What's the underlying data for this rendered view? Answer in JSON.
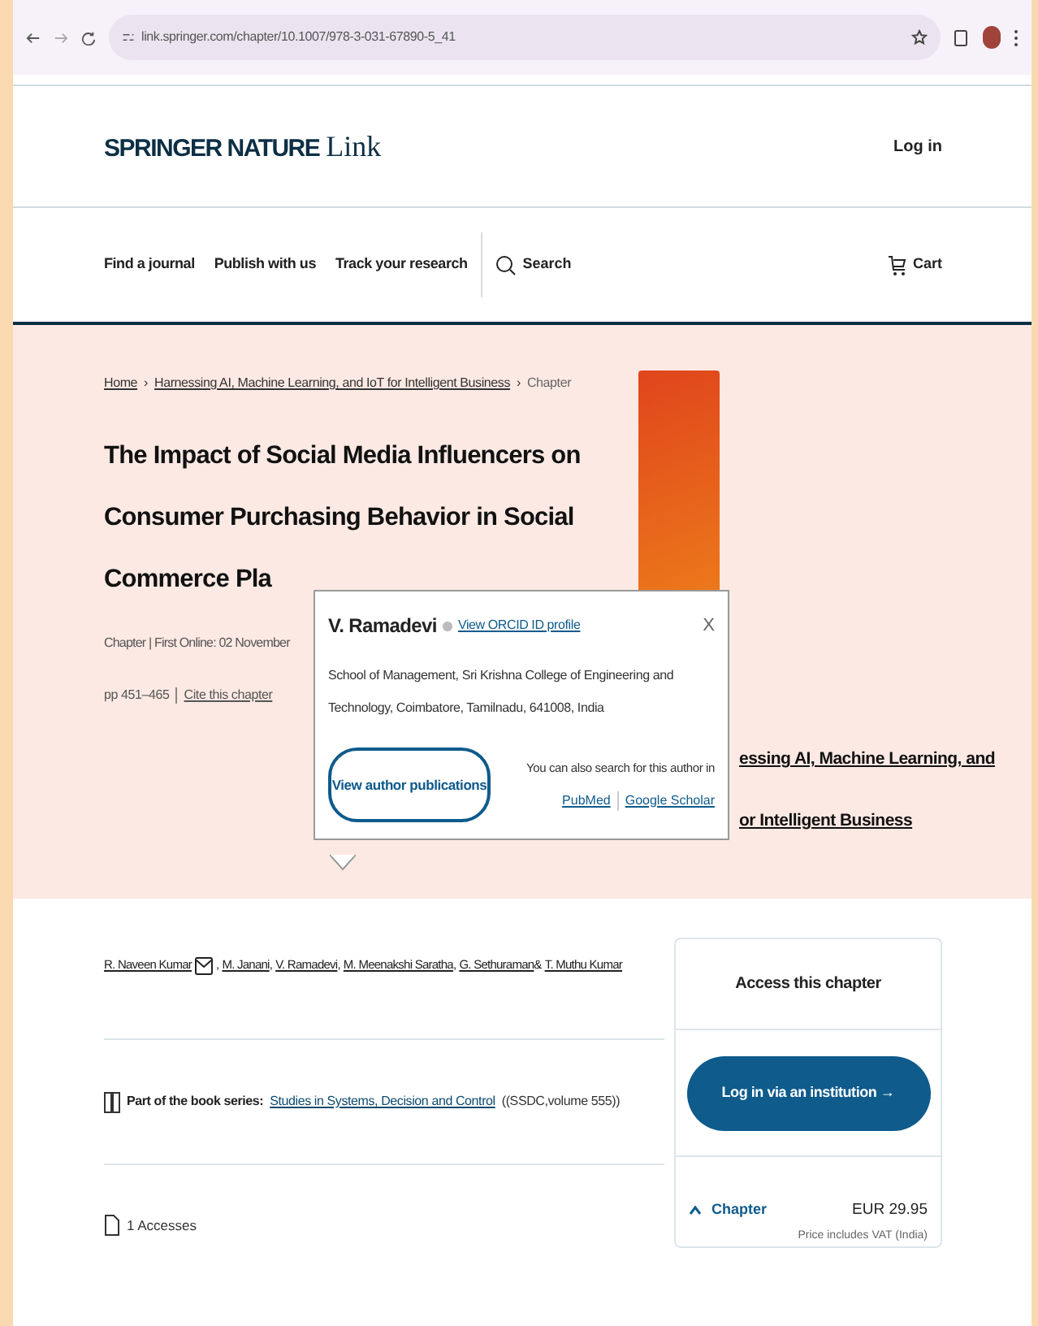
{
  "browser": {
    "url": "link.springer.com/chapter/10.1007/978-3-031-67890-5_41"
  },
  "header": {
    "logo_bold": "SPRINGER NATURE",
    "logo_light": "Link",
    "login": "Log in"
  },
  "nav": {
    "items": [
      "Find a journal",
      "Publish with us",
      "Track your research"
    ],
    "search": "Search",
    "cart": "Cart"
  },
  "breadcrumb": [
    {
      "label": "Home",
      "link": true
    },
    {
      "separator": "›",
      "label": "Harnessing AI, Machine Learning, and IoT for Intelligent Business",
      "link": true
    },
    {
      "separator": "›",
      "label": "Chapter",
      "link": false
    }
  ],
  "title_lines": [
    "The Impact of Social Media Influencers on",
    "Consumer Purchasing Behavior in Social",
    "Commerce Pla"
  ],
  "meta": {
    "line": "Chapter | First Online: 02 November",
    "pages": "pp 451–465",
    "cite": "Cite this chapter"
  },
  "book": {
    "title_lines": [
      "essing AI, Machine Learning, and",
      "or Intelligent Business"
    ]
  },
  "popup": {
    "name": "V. Ramadevi",
    "orcid": "View ORCID ID profile",
    "affiliation": "School of Management, Sri Krishna College of Engineering and Technology, Coimbatore, Tamilnadu, 641008, India",
    "close": "X",
    "button": "View author publications",
    "search_text": "You can also search for this author in",
    "links": [
      "PubMed",
      "Google Scholar"
    ]
  },
  "authors": [
    {
      "name": "R. Naveen Kumar",
      "email": true,
      "separator": ","
    },
    {
      "name": "M. Janani",
      "email": false,
      "separator": ","
    },
    {
      "name": "V. Ramadevi",
      "email": false,
      "separator": ","
    },
    {
      "name": "M. Meenakshi Saratha",
      "email": false,
      "separator": ","
    },
    {
      "name": "G. Sethuraman",
      "email": false,
      "separator": "&"
    },
    {
      "name": "T. Muthu Kumar",
      "email": false
    }
  ],
  "series": {
    "label": "Part of the book series:",
    "link": "Studies in Systems, Decision and Control",
    "suffix": "((SSDC,volume 555))"
  },
  "accesses": "1 Accesses",
  "access_card": {
    "title": "Access this chapter",
    "button": "Log in via an institution",
    "button_arrow": "→",
    "item": {
      "label": "Chapter",
      "expanded": true,
      "price": "EUR 29.95",
      "note": "Price includes VAT (India)"
    }
  }
}
